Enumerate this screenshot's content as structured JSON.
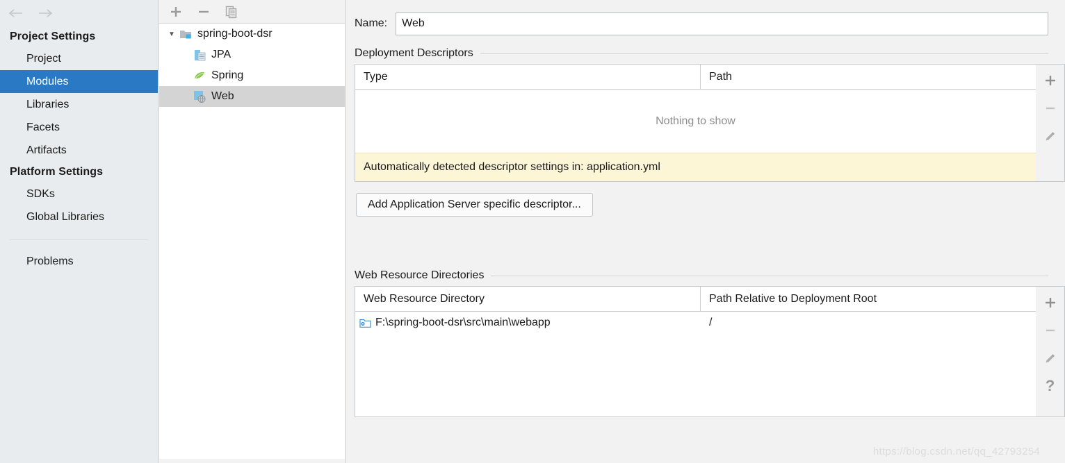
{
  "nav": {
    "back": "←",
    "forward": "→"
  },
  "sidebar": {
    "groups": [
      {
        "title": "Project Settings",
        "items": [
          {
            "label": "Project",
            "selected": false
          },
          {
            "label": "Modules",
            "selected": true
          },
          {
            "label": "Libraries",
            "selected": false
          },
          {
            "label": "Facets",
            "selected": false
          },
          {
            "label": "Artifacts",
            "selected": false
          }
        ]
      },
      {
        "title": "Platform Settings",
        "items": [
          {
            "label": "SDKs",
            "selected": false
          },
          {
            "label": "Global Libraries",
            "selected": false
          }
        ]
      }
    ],
    "problems": "Problems",
    "selected_color": "#2a79c4"
  },
  "tree": {
    "toolbar": [
      {
        "name": "add-module-button",
        "glyph": "+"
      },
      {
        "name": "remove-module-button",
        "glyph": "−"
      },
      {
        "name": "copy-module-button",
        "glyph": "copy"
      }
    ],
    "root": {
      "label": "spring-boot-dsr",
      "expanded": true,
      "toggle": "▼"
    },
    "children": [
      {
        "label": "JPA",
        "icon": "jpa-facet-icon",
        "selected": false
      },
      {
        "label": "Spring",
        "icon": "spring-facet-icon",
        "selected": false
      },
      {
        "label": "Web",
        "icon": "web-facet-icon",
        "selected": true
      }
    ]
  },
  "main": {
    "name_label": "Name:",
    "name_value": "Web",
    "name_placeholder": "",
    "deployment": {
      "section_title": "Deployment Descriptors",
      "columns": [
        "Type",
        "Path"
      ],
      "rows": [],
      "empty_text": "Nothing to show",
      "banner": "Automatically detected descriptor settings in: application.yml",
      "banner_color": "#fcf6d7",
      "toolbar": [
        {
          "name": "add-descriptor-button",
          "glyph": "+"
        },
        {
          "name": "remove-descriptor-button",
          "glyph": "−"
        },
        {
          "name": "edit-descriptor-button",
          "glyph": "pencil"
        }
      ],
      "add_button": "Add Application Server specific descriptor..."
    },
    "web_resources": {
      "section_title": "Web Resource Directories",
      "columns": [
        "Web Resource Directory",
        "Path Relative to Deployment Root"
      ],
      "rows": [
        {
          "directory": "F:\\spring-boot-dsr\\src\\main\\webapp",
          "relative_path": "/",
          "icon": "web-resource-folder-icon"
        }
      ],
      "toolbar": [
        {
          "name": "add-web-resource-button",
          "glyph": "+"
        },
        {
          "name": "remove-web-resource-button",
          "glyph": "−"
        },
        {
          "name": "edit-web-resource-button",
          "glyph": "pencil"
        },
        {
          "name": "help-button",
          "glyph": "?"
        }
      ]
    }
  },
  "watermark": "https://blog.csdn.net/qq_42793254"
}
